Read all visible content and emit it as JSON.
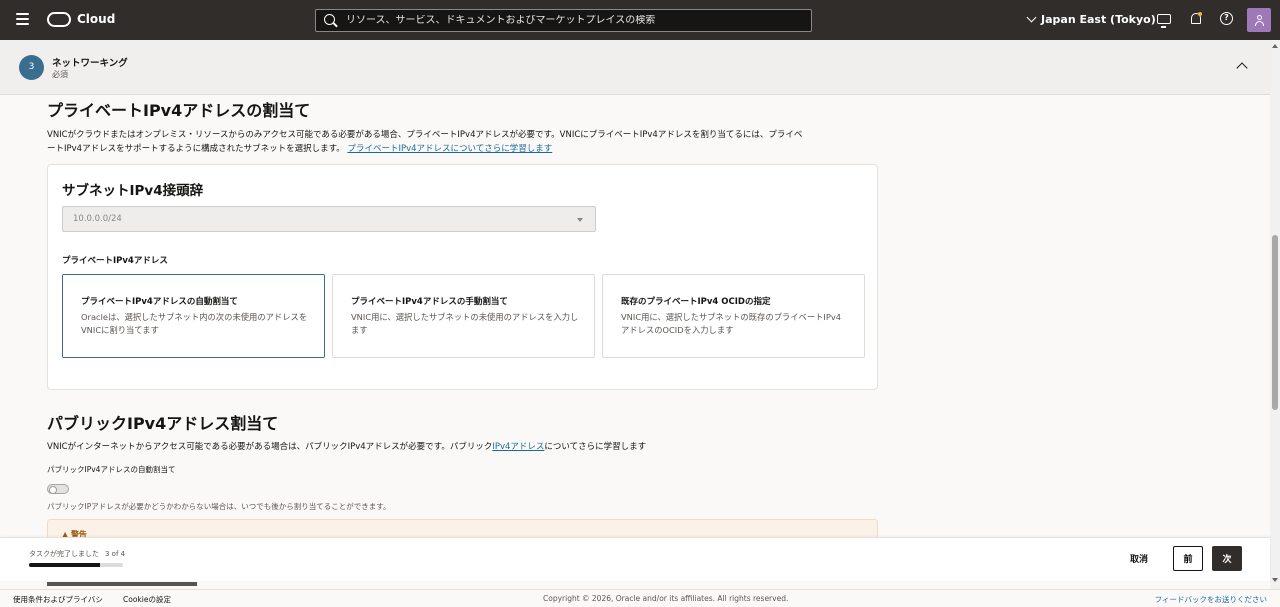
{
  "topbar": {
    "brand": "Cloud",
    "search_placeholder": "リソース、サービス、ドキュメントおよびマーケットプレイスの検索",
    "region": "Japan East (Tokyo)",
    "help_glyph": "?"
  },
  "step": {
    "number": "3",
    "title": "ネットワーキング",
    "subtitle": "必須"
  },
  "private_ipv4": {
    "heading": "プライベートIPv4アドレスの割当て",
    "desc_line1": "VNICがクラウドまたはオンプレミス・リソースからのみアクセス可能である必要がある場合、プライベートIPv4アドレスが必要です。VNICにプライベートIPv4アドレスを割り当てるには、プライベ",
    "desc_line2": "ートIPv4アドレスをサポートするように構成されたサブネットを選択します。",
    "learn_more": "プライベートIPv4アドレスについてさらに学習します",
    "panel_title": "サブネットIPv4接頭辞",
    "subnet_value": "10.0.0.0/24",
    "private_label": "プライベートIPv4アドレス",
    "cards": [
      {
        "title": "プライベートIPv4アドレスの自動割当て",
        "desc": "Oracleは、選択したサブネット内の次の未使用のアドレスをVNICに割り当てます"
      },
      {
        "title": "プライベートIPv4アドレスの手動割当て",
        "desc": "VNIC用に、選択したサブネットの未使用のアドレスを入力します"
      },
      {
        "title": "既存のプライベートIPv4 OCIDの指定",
        "desc": "VNIC用に、選択したサブネットの既存のプライベートIPv4アドレスのOCIDを入力します"
      }
    ]
  },
  "public_ipv4": {
    "heading": "パブリックIPv4アドレス割当て",
    "desc_prefix": "VNICがインターネットからアクセス可能である必要がある場合は、パブリックIPv4アドレスが必要です。パブリック",
    "desc_link": "IPv4アドレス",
    "desc_suffix": "についてさらに学習します",
    "toggle_label": "パブリックIPv4アドレスの自動割当て",
    "hint": "パブリックIPアドレスが必要かどうかわからない場合は、いつでも後から割り当てることができます。",
    "warning_title": "▲ 警告"
  },
  "progress": {
    "label": "タスクが完了しました",
    "count": "3 of 4",
    "fraction": 0.75,
    "cancel": "取消",
    "prev": "前",
    "next": "次"
  },
  "footer": {
    "terms": "使用条件およびプライバシ",
    "cookie": "Cookieの設定",
    "copyright": "Copyright © 2026, Oracle and/or its affiliates. All rights reserved.",
    "feedback": "フィードバックをお送りください"
  }
}
